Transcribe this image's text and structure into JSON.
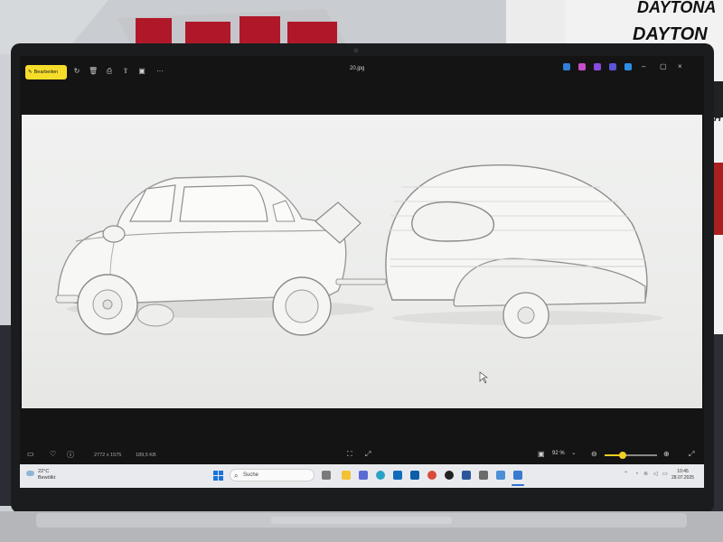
{
  "background": {
    "poster_text_1": "DAYTONA",
    "poster_text_2": "DAYTON",
    "poster_text_3": "CH"
  },
  "titlebar": {
    "edit_button_label": "Bearbeiten",
    "filename": "20.jpg",
    "close_glyph": "×",
    "maximize_glyph": "▢",
    "minimize_glyph": "–",
    "more_glyph": "···"
  },
  "statusbar": {
    "dimensions": "2772 x 1575",
    "file_size": "189,5 KB",
    "zoom_level": "92 %",
    "zoom_fraction": 0.35
  },
  "taskbar": {
    "weather_temp": "22°C",
    "weather_desc": "Bewölkt",
    "search_placeholder": "Suche",
    "time": "10:45",
    "date": "28.07.2025"
  },
  "colors": {
    "edit_button": "#f6dd2a",
    "zoom_accent": "#f0d020",
    "taskbar_bg": "#e9eaed"
  }
}
